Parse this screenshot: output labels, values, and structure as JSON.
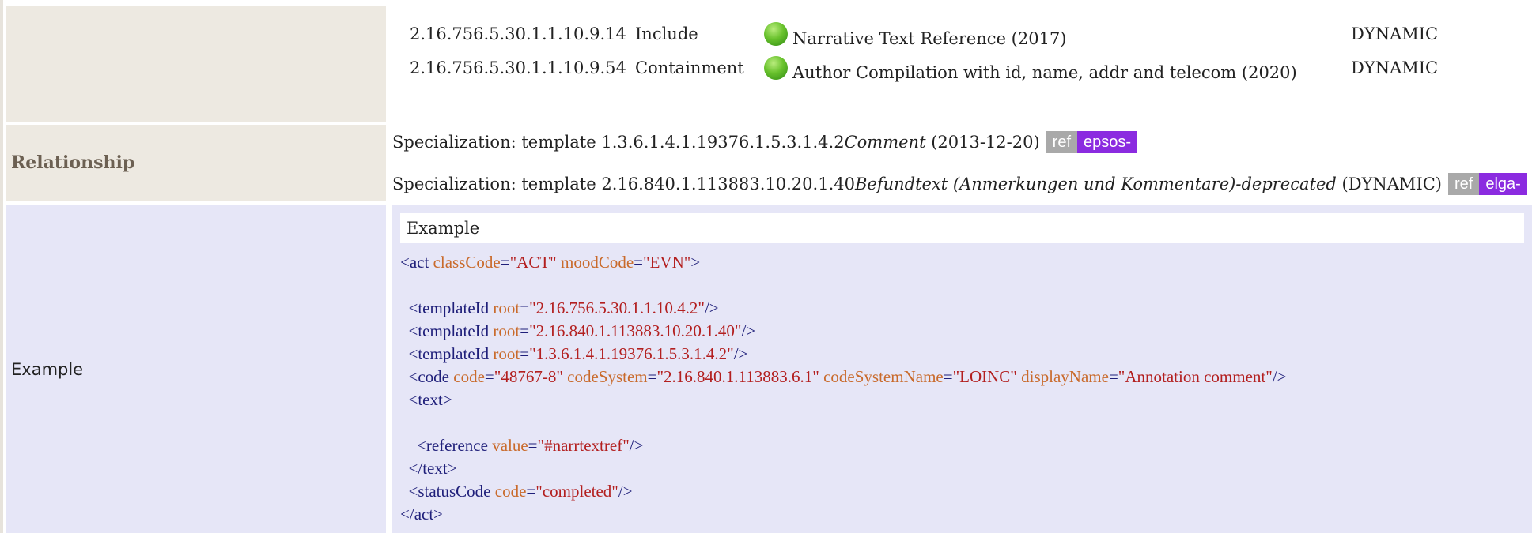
{
  "includes": [
    {
      "oid": "2.16.756.5.30.1.1.10.9.14",
      "type": "Include",
      "name": "Narrative Text Reference (2017)",
      "flexibility": "DYNAMIC"
    },
    {
      "oid": "2.16.756.5.30.1.1.10.9.54",
      "type": "Containment",
      "name": "Author Compilation with id, name, addr and telecom (2020)",
      "flexibility": "DYNAMIC"
    }
  ],
  "relationship": {
    "label": "Relationship",
    "items": [
      {
        "prefix": "Specialization: template 1.3.6.1.4.1.19376.1.5.3.1.4.2 ",
        "name": "Comment",
        "suffix": " (2013-12-20)",
        "ref": "ref",
        "project": "epsos-"
      },
      {
        "prefix": "Specialization: template 2.16.840.1.113883.10.20.1.40 ",
        "name": "Befundtext (Anmerkungen und Kommentare)-deprecated",
        "suffix": " (DYNAMIC)",
        "ref": "ref",
        "project": "elga-"
      }
    ]
  },
  "example": {
    "label": "Example",
    "header": "Example"
  },
  "colors": {
    "project_badge": "#8b2be0",
    "ref_badge": "#a9a9a9",
    "status_ball": "#69c22d"
  }
}
